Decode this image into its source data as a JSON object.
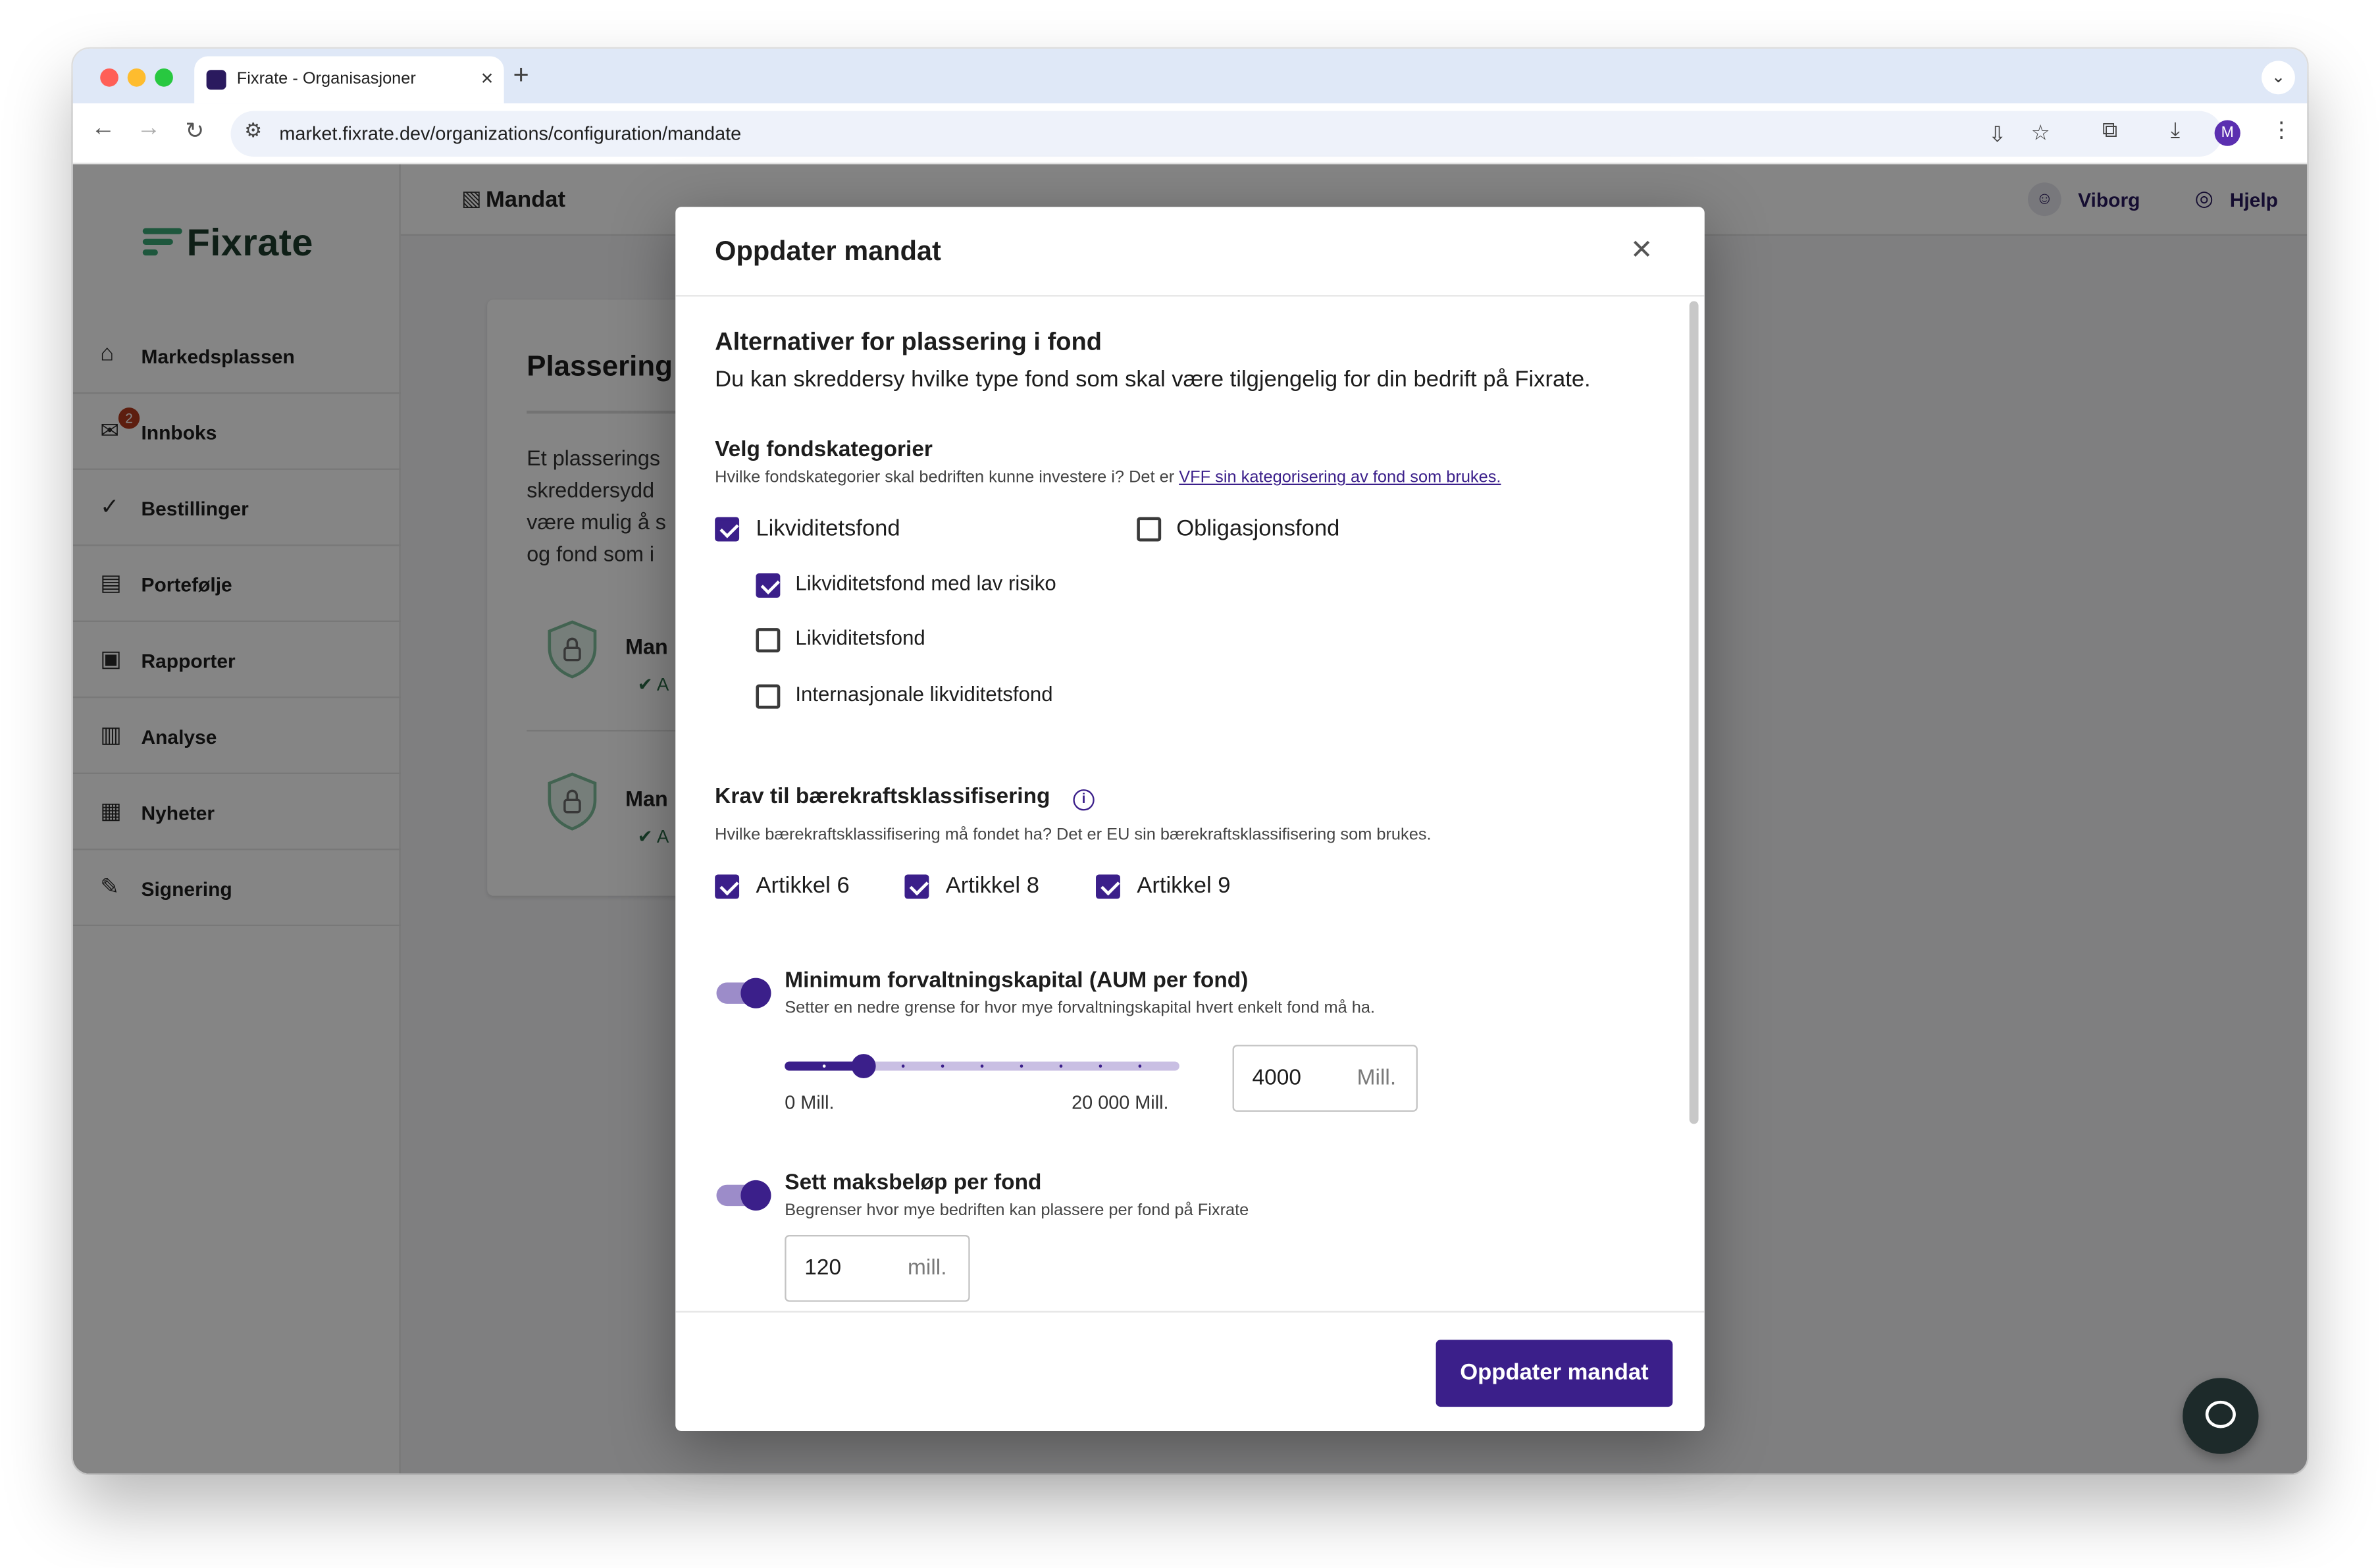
{
  "browser": {
    "tab_title": "Fixrate - Organisasjoner",
    "url": "market.fixrate.dev/organizations/configuration/mandate",
    "avatar_initial": "M",
    "traffic_colors": [
      "#ff5f57",
      "#febc2e",
      "#28c840"
    ]
  },
  "sidebar": {
    "logo": "Fixrate",
    "items": [
      {
        "label": "Markedsplassen",
        "icon": "store-icon"
      },
      {
        "label": "Innboks",
        "icon": "inbox-icon",
        "badge": "2"
      },
      {
        "label": "Bestillinger",
        "icon": "check-circle-icon"
      },
      {
        "label": "Portefølje",
        "icon": "briefcase-icon"
      },
      {
        "label": "Rapporter",
        "icon": "report-icon"
      },
      {
        "label": "Analyse",
        "icon": "analytics-icon"
      },
      {
        "label": "Nyheter",
        "icon": "news-icon"
      },
      {
        "label": "Signering",
        "icon": "signature-icon"
      }
    ]
  },
  "header": {
    "page_title": "Mandat",
    "user": "Viborg",
    "help": "Hjelp"
  },
  "background_card": {
    "title": "Plassering",
    "text_lines": [
      "Et plasserings",
      "skreddersydd",
      "være mulig å s",
      "og fond som i"
    ],
    "mandates": [
      "Man",
      "Man"
    ],
    "status_letter": "A"
  },
  "modal": {
    "title": "Oppdater mandat",
    "section_title": "Alternativer for plassering i fond",
    "section_desc": "Du kan skreddersy hvilke type fond som skal være tilgjengelig for din bedrift på Fixrate.",
    "fund_categories": {
      "title": "Velg fondskategorier",
      "desc_prefix": "Hvilke fondskategorier skal bedriften kunne investere i? Det er ",
      "desc_link": "VFF sin kategorisering av fond som brukes.",
      "options": [
        {
          "label": "Likviditetsfond",
          "checked": true
        },
        {
          "label": "Obligasjonsfond",
          "checked": false
        }
      ],
      "sub_options": [
        {
          "label": "Likviditetsfond med lav risiko",
          "checked": true
        },
        {
          "label": "Likviditetsfond",
          "checked": false
        },
        {
          "label": "Internasjonale likviditetsfond",
          "checked": false
        }
      ]
    },
    "sustainability": {
      "title": "Krav til bærekraftsklassifisering",
      "desc": "Hvilke bærekraftsklassifisering må fondet ha? Det er EU sin bærekraftsklassifisering som brukes.",
      "options": [
        {
          "label": "Artikkel 6",
          "checked": true
        },
        {
          "label": "Artikkel 8",
          "checked": true
        },
        {
          "label": "Artikkel 9",
          "checked": true
        }
      ]
    },
    "min_aum": {
      "enabled": true,
      "title": "Minimum forvaltningskapital (AUM per fond)",
      "desc": "Setter en nedre grense for hvor mye forvaltningskapital hvert enkelt fond må ha.",
      "slider_min_label": "0 Mill.",
      "slider_max_label": "20 000 Mill.",
      "slider_min": 0,
      "slider_max": 20000,
      "value": "4000",
      "unit": "Mill."
    },
    "max_amount": {
      "enabled": true,
      "title": "Sett maksbeløp per fond",
      "desc": "Begrenser hvor mye bedriften kan plassere per fond på Fixrate",
      "value": "120",
      "unit": "mill."
    },
    "submit_label": "Oppdater mandat"
  }
}
